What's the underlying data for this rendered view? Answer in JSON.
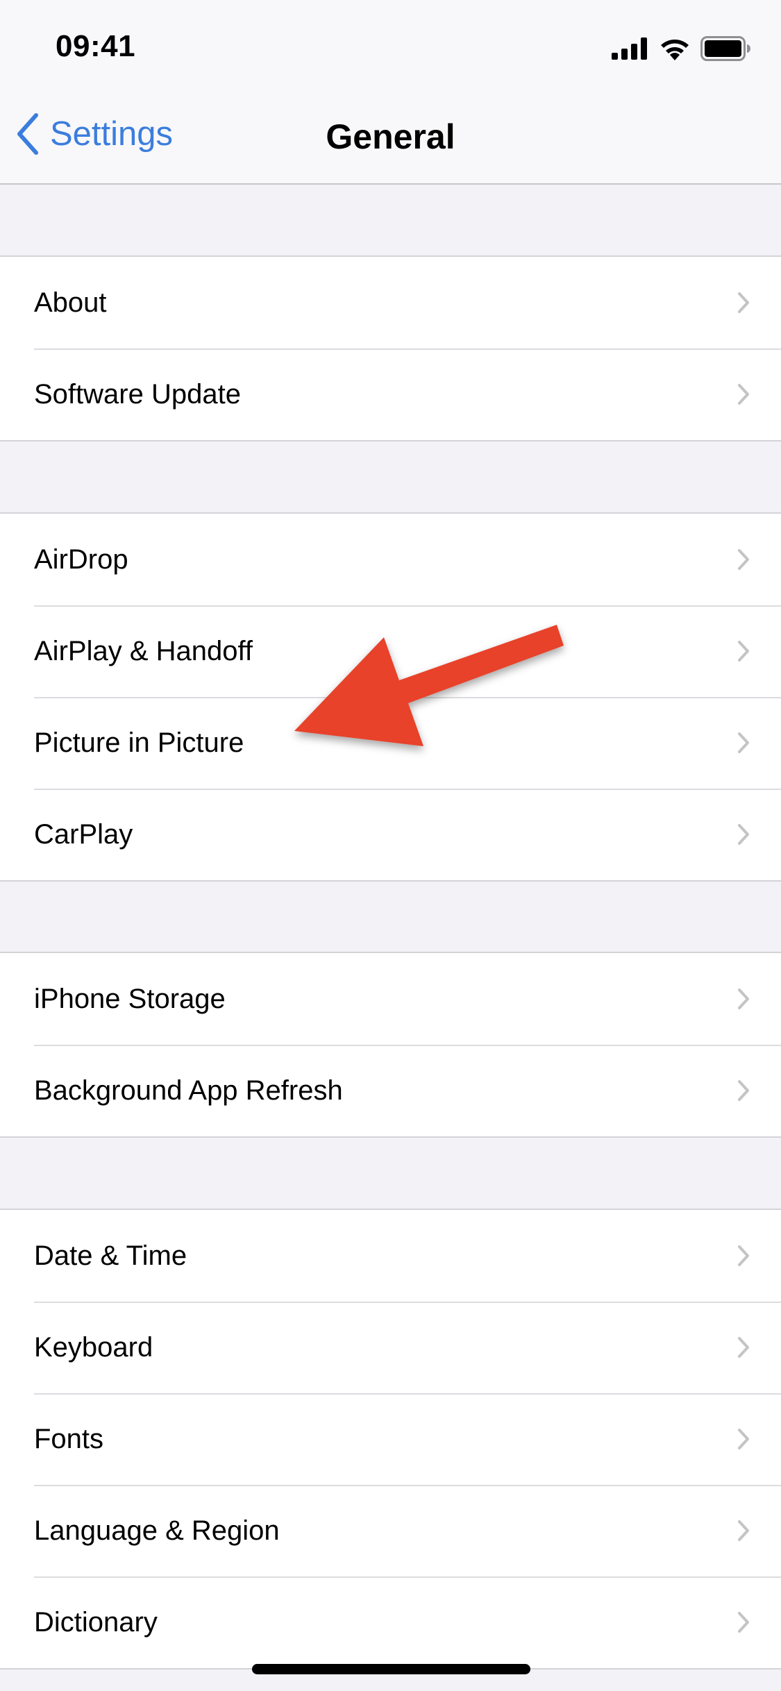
{
  "status_bar": {
    "time": "09:41",
    "icons": [
      "cellular-signal-icon",
      "wifi-icon",
      "battery-icon"
    ]
  },
  "nav": {
    "back_label": "Settings",
    "back_icon": "chevron-left-icon",
    "title": "General"
  },
  "sections": [
    {
      "items": [
        {
          "label": "About"
        },
        {
          "label": "Software Update"
        }
      ]
    },
    {
      "items": [
        {
          "label": "AirDrop"
        },
        {
          "label": "AirPlay & Handoff"
        },
        {
          "label": "Picture in Picture"
        },
        {
          "label": "CarPlay"
        }
      ]
    },
    {
      "items": [
        {
          "label": "iPhone Storage"
        },
        {
          "label": "Background App Refresh"
        }
      ]
    },
    {
      "items": [
        {
          "label": "Date & Time"
        },
        {
          "label": "Keyboard"
        },
        {
          "label": "Fonts"
        },
        {
          "label": "Language & Region"
        },
        {
          "label": "Dictionary"
        }
      ]
    }
  ],
  "annotation": {
    "type": "arrow",
    "points_to": "Picture in Picture",
    "color": "#e8432a"
  },
  "colors": {
    "accent": "#3b7ddd",
    "chevron": "#c4c4c7",
    "grouped_background": "#f2f2f7"
  }
}
